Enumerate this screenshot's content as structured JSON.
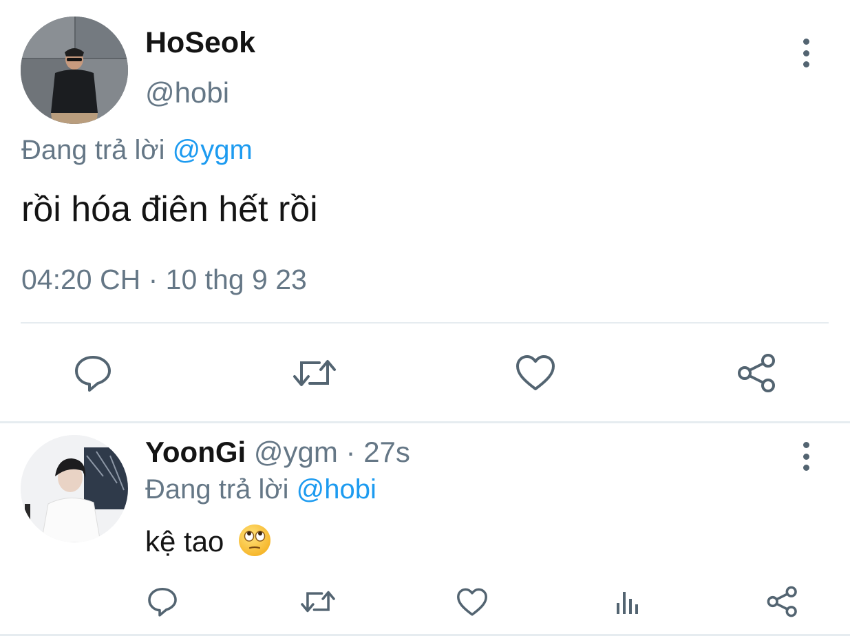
{
  "main_tweet": {
    "author_name": "HoSeok",
    "author_handle": "@hobi",
    "replying_prefix": "Đang trả lời",
    "replying_to": "@ygm",
    "text": "rồi hóa điên hết rồi",
    "timestamp": "04:20 CH · 10 thg 9 23",
    "actions": [
      "reply-icon",
      "retweet-icon",
      "like-icon",
      "share-icon"
    ]
  },
  "reply_tweet": {
    "author_name": "YoonGi",
    "author_handle": "@ygm",
    "separator": "·",
    "time_ago": "27s",
    "replying_prefix": "Đang trả lời",
    "replying_to": "@hobi",
    "text": "kệ tao",
    "emoji": "face-with-rolling-eyes",
    "actions": [
      "reply-icon",
      "retweet-icon",
      "like-icon",
      "views-icon",
      "share-icon"
    ]
  },
  "colors": {
    "text": "#141414",
    "muted": "#657786",
    "mention": "#1d9bf0",
    "icon": "#536471",
    "divider": "#e6ecf0"
  }
}
